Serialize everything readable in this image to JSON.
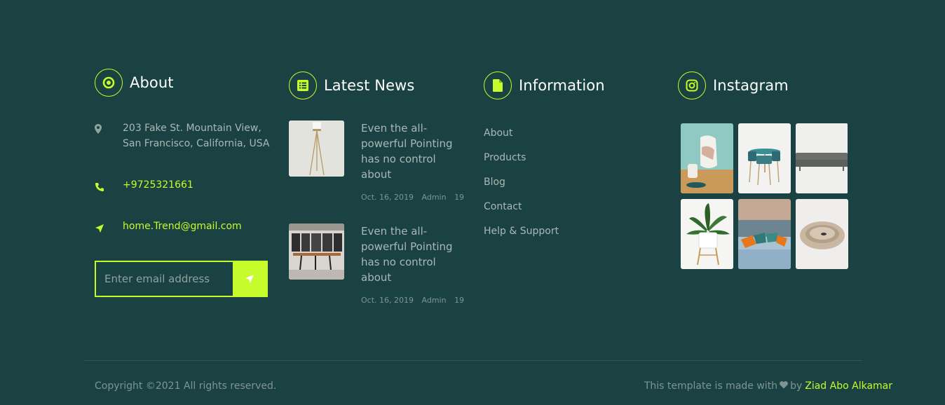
{
  "about": {
    "title": "About",
    "address": "203 Fake St. Mountain View, San Francisco, California, USA",
    "phone": "+9725321661",
    "email": "home.Trend@gmail.com",
    "subscribe_placeholder": "Enter email address"
  },
  "news": {
    "title": "Latest News",
    "items": [
      {
        "title": "Even the all-powerful Pointing has no control about",
        "date": "Oct. 16, 2019",
        "author": "Admin",
        "comments": "19"
      },
      {
        "title": "Even the all-powerful Pointing has no control about",
        "date": "Oct. 16, 2019",
        "author": "Admin",
        "comments": "19"
      }
    ]
  },
  "information": {
    "title": "Information",
    "links": [
      "About",
      "Products",
      "Blog",
      "Contact",
      "Help & Support"
    ]
  },
  "instagram": {
    "title": "Instagram"
  },
  "footer": {
    "copyright": "Copyright ©2021 All rights reserved.",
    "credit_prefix": "This template is made with",
    "credit_by": "by",
    "credit_author": "Ziad Abo Alkamar"
  },
  "colors": {
    "background": "#1a4242",
    "accent": "#c6fb2c",
    "text": "#a9b8b6"
  }
}
